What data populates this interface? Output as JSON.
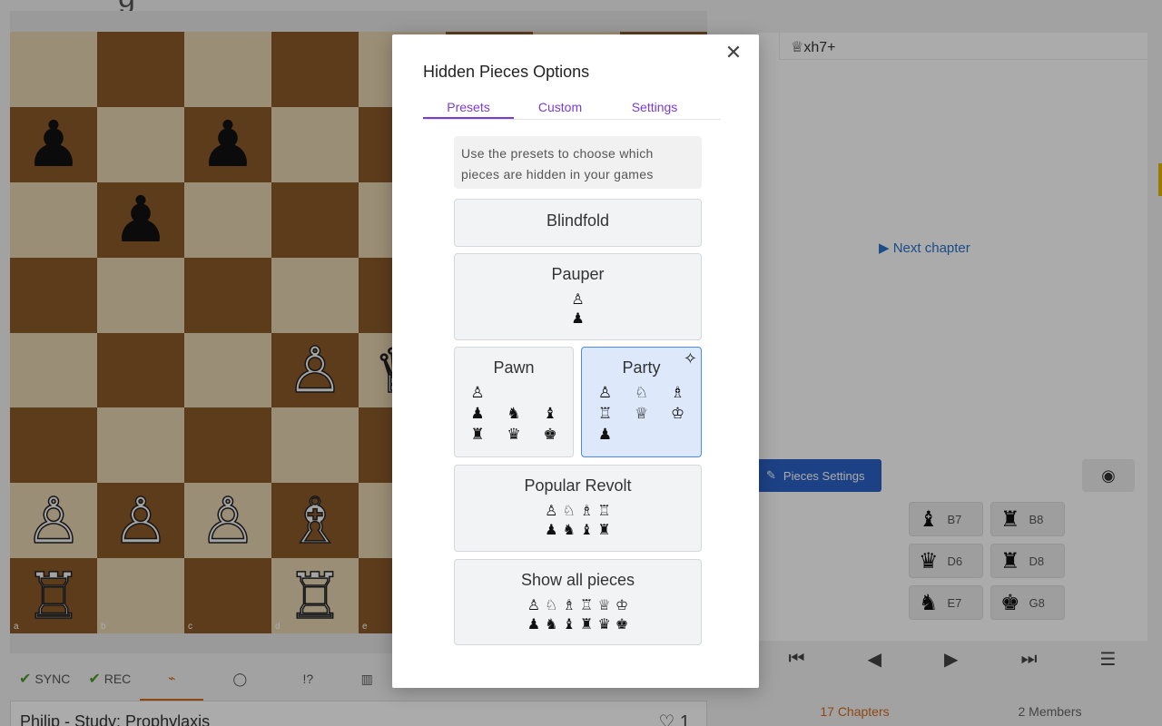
{
  "background": {
    "title_fragment": "g",
    "board_files": [
      "a",
      "b",
      "c",
      "d",
      "e"
    ],
    "board_rows": [
      [
        "",
        "",
        "",
        "",
        "",
        "",
        "",
        ""
      ],
      [
        "♟",
        "",
        "♟",
        "",
        "",
        "",
        "",
        ""
      ],
      [
        "",
        "♟",
        "",
        "",
        "",
        "",
        "",
        ""
      ],
      [
        "",
        "",
        "",
        "",
        "",
        "",
        "",
        ""
      ],
      [
        "",
        "",
        "",
        "♙",
        "♕",
        "",
        "",
        ""
      ],
      [
        "",
        "",
        "",
        "",
        "",
        "",
        "",
        ""
      ],
      [
        "♙",
        "♙",
        "♙",
        "♗",
        "",
        "",
        "",
        ""
      ],
      [
        "♖",
        "",
        "",
        "♖",
        "",
        "",
        "",
        ""
      ]
    ],
    "toolbar": {
      "sync": "SYNC",
      "rec": "REC",
      "tags_icon": "tag-icon",
      "comment_icon": "comment-icon",
      "annotate": "!?",
      "chart_icon": "chart-icon"
    },
    "study_title": "Philip - Study: Prophylaxis",
    "likes": "1",
    "move_text": "♕xh7+",
    "next_chapter": "Next chapter",
    "pieces_settings": "Pieces Settings",
    "hidden_chips": [
      {
        "glyph": "♝",
        "square": "B7"
      },
      {
        "glyph": "♜",
        "square": "B8"
      },
      {
        "glyph": "♛",
        "square": "D6"
      },
      {
        "glyph": "♜",
        "square": "D8"
      },
      {
        "glyph": "♞",
        "square": "E7"
      },
      {
        "glyph": "♚",
        "square": "G8"
      }
    ],
    "controls": [
      "⏮",
      "◀",
      "▶",
      "⏭",
      "☰"
    ],
    "chapters": "17 Chapters",
    "members": "2 Members"
  },
  "modal": {
    "title": "Hidden Pieces Options",
    "close_glyph": "✕",
    "tabs": [
      "Presets",
      "Custom",
      "Settings"
    ],
    "hint": "Use the presets to choose which pieces are hidden in your games",
    "presets": {
      "blindfold": {
        "title": "Blindfold"
      },
      "pauper": {
        "title": "Pauper",
        "white": "♙",
        "black": "♟"
      },
      "pawn": {
        "title": "Pawn",
        "row1": "♙",
        "grid": [
          "♟",
          "♞",
          "♝",
          "♜",
          "♛",
          "♚"
        ]
      },
      "party": {
        "title": "Party",
        "sparkle": "✧",
        "grid": [
          "♙",
          "♘",
          "♗",
          "♖",
          "♕",
          "♔",
          "♟",
          "",
          ""
        ]
      },
      "popular_revolt": {
        "title": "Popular Revolt",
        "white": "♙ ♘ ♗ ♖",
        "black": "♟ ♞ ♝ ♜"
      },
      "show_all": {
        "title": "Show all pieces",
        "white": "♙ ♘ ♗ ♖ ♕ ♔",
        "black": "♟ ♞ ♝ ♜ ♛ ♚"
      }
    }
  }
}
